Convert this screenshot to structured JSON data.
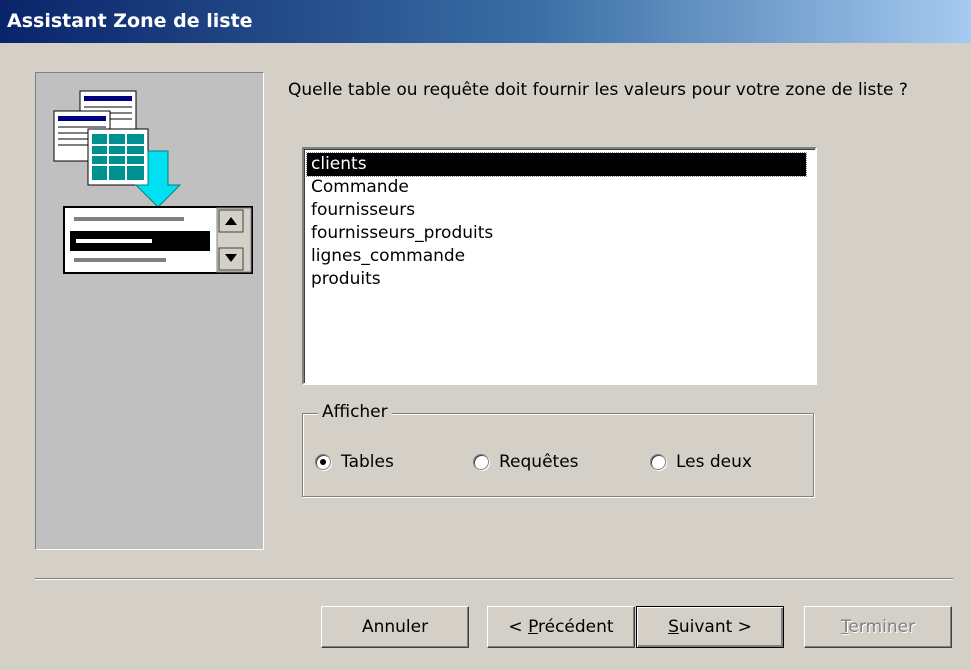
{
  "window": {
    "title": "Assistant Zone de liste"
  },
  "illustration": {
    "icons": [
      "table-stack-icon",
      "arrow-down-icon",
      "list-box-icon"
    ],
    "colors": {
      "accent_cyan": "#00e0f0",
      "table_teal": "#009090",
      "list_selection": "#000080"
    }
  },
  "main": {
    "question": "Quelle table ou requête doit fournir les valeurs pour votre zone de liste ?",
    "list": {
      "selected": "clients",
      "items": [
        {
          "label": "clients"
        },
        {
          "label": "Commande"
        },
        {
          "label": "fournisseurs"
        },
        {
          "label": "fournisseurs_produits"
        },
        {
          "label": "lignes_commande"
        },
        {
          "label": "produits"
        }
      ]
    },
    "show_group": {
      "legend": "Afficher",
      "selected": "Tables",
      "options": [
        {
          "label": "Tables"
        },
        {
          "label": "Requêtes"
        },
        {
          "label": "Les deux"
        }
      ]
    }
  },
  "footer": {
    "cancel": "Annuler",
    "back_prefix": "< ",
    "back_accel": "P",
    "back_rest": "récédent",
    "next_accel": "S",
    "next_rest": "uivant >",
    "finish_accel": "T",
    "finish_rest": "erminer"
  }
}
